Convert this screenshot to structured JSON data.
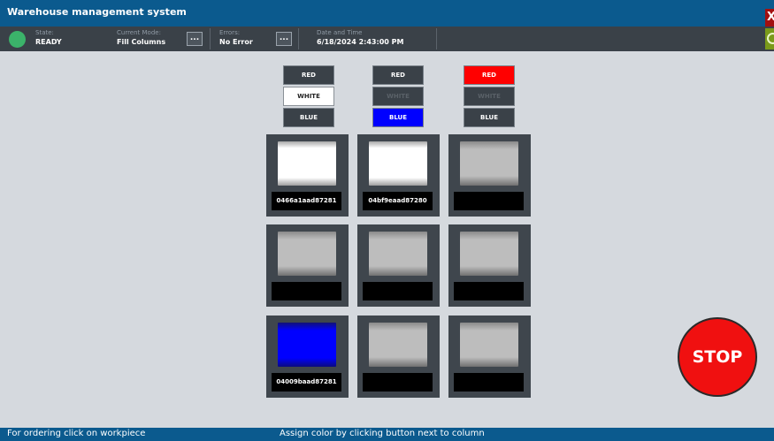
{
  "window": {
    "title": "Warehouse management system",
    "close_label": "X"
  },
  "status": {
    "state_label": "State:",
    "state_value": "READY",
    "mode_label": "Current Mode:",
    "mode_value": "Fill Columns",
    "errors_label": "Errors:",
    "errors_value": "No Error",
    "datetime_label": "Date and Time",
    "datetime_value": "6/18/2024 2:43:00 PM",
    "dots": "..."
  },
  "columns": [
    {
      "buttons": [
        {
          "label": "RED",
          "state": "normal"
        },
        {
          "label": "WHITE",
          "state": "active-white"
        },
        {
          "label": "BLUE",
          "state": "normal"
        }
      ]
    },
    {
      "buttons": [
        {
          "label": "RED",
          "state": "normal"
        },
        {
          "label": "WHITE",
          "state": "dim"
        },
        {
          "label": "BLUE",
          "state": "active-blue"
        }
      ]
    },
    {
      "buttons": [
        {
          "label": "RED",
          "state": "active-red"
        },
        {
          "label": "WHITE",
          "state": "dim"
        },
        {
          "label": "BLUE",
          "state": "normal"
        }
      ]
    }
  ],
  "grid": [
    [
      {
        "color": "white",
        "id": "0466a1aad87281"
      },
      {
        "color": "white",
        "id": "04bf9eaad87280"
      },
      {
        "color": "gray",
        "id": ""
      }
    ],
    [
      {
        "color": "gray",
        "id": ""
      },
      {
        "color": "gray",
        "id": ""
      },
      {
        "color": "gray",
        "id": ""
      }
    ],
    [
      {
        "color": "blue",
        "id": "04009baad87281"
      },
      {
        "color": "gray",
        "id": ""
      },
      {
        "color": "gray",
        "id": ""
      }
    ]
  ],
  "stop_label": "STOP",
  "footer": {
    "left": "For ordering click on workpiece",
    "center": "Assign color by clicking button next to column"
  },
  "colors": {
    "accent": "#0b5a8e",
    "status_ok": "#3bb36a",
    "stop": "#f01010",
    "blue": "#0000ff",
    "red": "#ff0000"
  }
}
